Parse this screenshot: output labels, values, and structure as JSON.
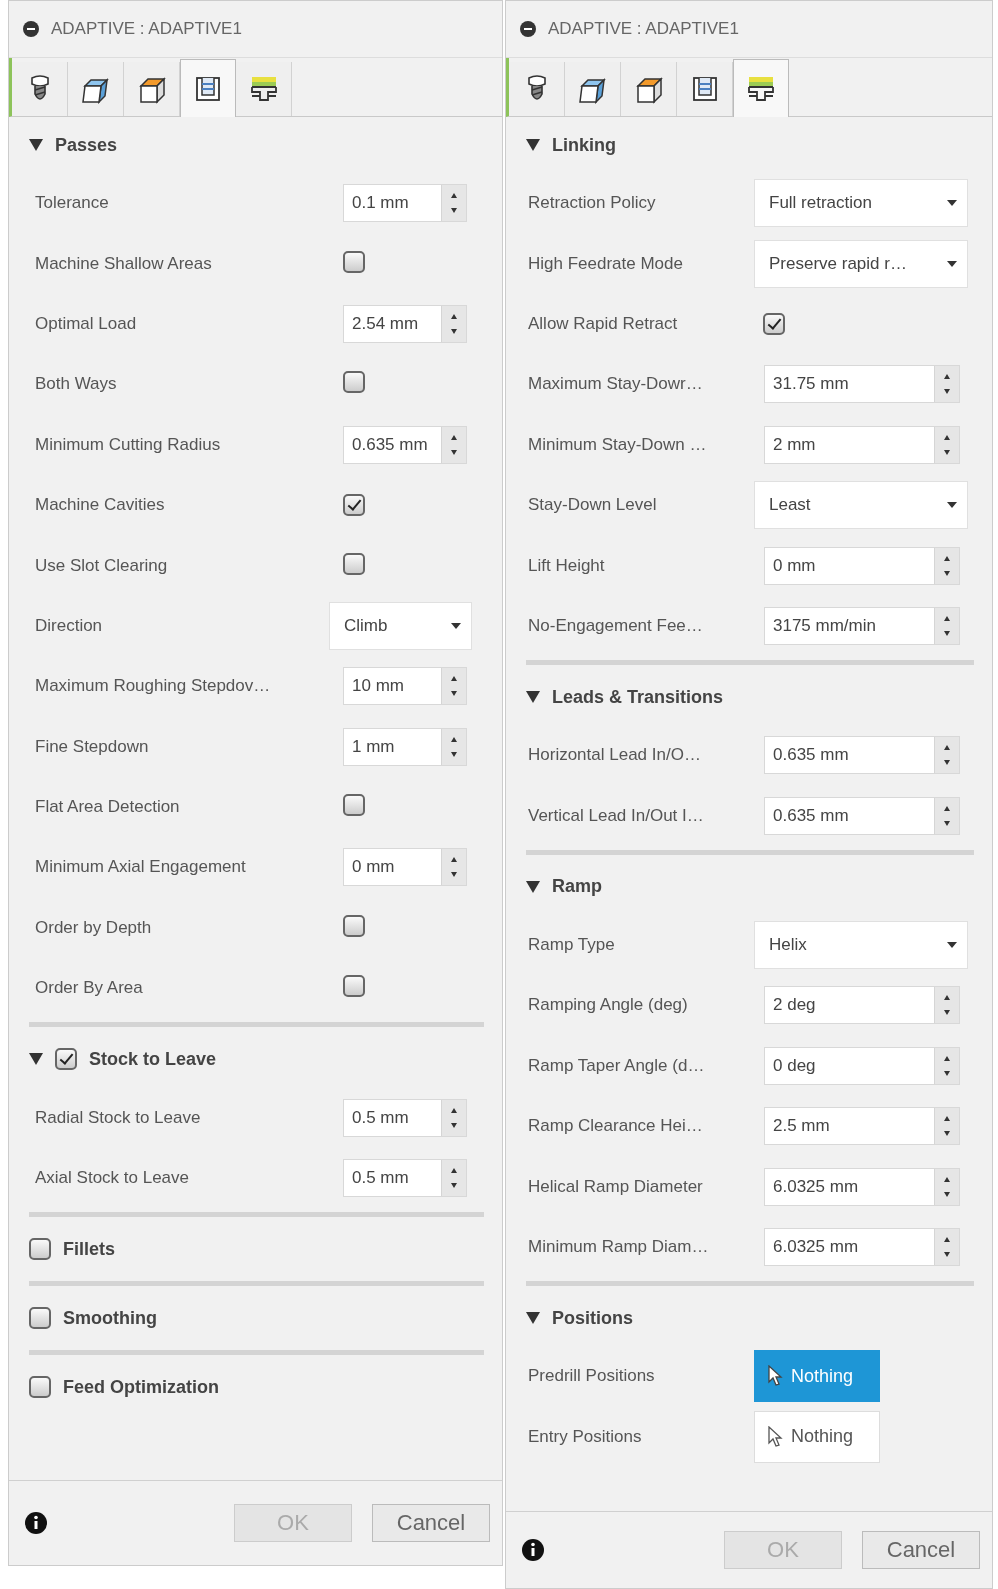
{
  "panels": [
    {
      "title": "ADAPTIVE : ADAPTIVE1",
      "tabs": [
        {
          "kind": "tool",
          "selected": false
        },
        {
          "kind": "geometry",
          "selected": false
        },
        {
          "kind": "heights",
          "selected": false
        },
        {
          "kind": "passes",
          "selected": true
        },
        {
          "kind": "linking",
          "selected": false
        }
      ],
      "sections": [
        {
          "kind": "group",
          "title": "Passes",
          "expanded": true,
          "rows": [
            {
              "kind": "spinner",
              "label": "Tolerance",
              "value": "0.1 mm"
            },
            {
              "kind": "checkbox",
              "label": "Machine Shallow Areas",
              "checked": false
            },
            {
              "kind": "spinner",
              "label": "Optimal Load",
              "value": "2.54 mm"
            },
            {
              "kind": "checkbox",
              "label": "Both Ways",
              "checked": false
            },
            {
              "kind": "spinner",
              "label": "Minimum Cutting Radius",
              "value": "0.635 mm"
            },
            {
              "kind": "checkbox",
              "label": "Machine Cavities",
              "checked": true
            },
            {
              "kind": "checkbox",
              "label": "Use Slot Clearing",
              "checked": false
            },
            {
              "kind": "dropdown",
              "label": "Direction",
              "value": "Climb"
            },
            {
              "kind": "spinner",
              "label": "Maximum Roughing Stepdov…",
              "value": "10 mm"
            },
            {
              "kind": "spinner",
              "label": "Fine Stepdown",
              "value": "1 mm"
            },
            {
              "kind": "checkbox",
              "label": "Flat Area Detection",
              "checked": false
            },
            {
              "kind": "spinner",
              "label": "Minimum Axial Engagement",
              "value": "0 mm"
            },
            {
              "kind": "checkbox",
              "label": "Order by Depth",
              "checked": false
            },
            {
              "kind": "checkbox",
              "label": "Order By Area",
              "checked": false
            }
          ]
        },
        {
          "kind": "check_group",
          "title": "Stock to Leave",
          "expanded": true,
          "checked": true,
          "rows": [
            {
              "kind": "spinner",
              "label": "Radial Stock to Leave",
              "value": "0.5 mm"
            },
            {
              "kind": "spinner",
              "label": "Axial Stock to Leave",
              "value": "0.5 mm"
            }
          ]
        },
        {
          "kind": "check",
          "title": "Fillets",
          "checked": false
        },
        {
          "kind": "check",
          "title": "Smoothing",
          "checked": false
        },
        {
          "kind": "check",
          "title": "Feed Optimization",
          "checked": false
        }
      ],
      "buttons": [
        {
          "label": "OK",
          "disabled": true
        },
        {
          "label": "Cancel",
          "disabled": false
        }
      ]
    },
    {
      "title": "ADAPTIVE : ADAPTIVE1",
      "tabs": [
        {
          "kind": "tool",
          "selected": false
        },
        {
          "kind": "geometry",
          "selected": false
        },
        {
          "kind": "heights",
          "selected": false
        },
        {
          "kind": "passes",
          "selected": false
        },
        {
          "kind": "linking",
          "selected": true
        }
      ],
      "sections": [
        {
          "kind": "group",
          "title": "Linking",
          "expanded": true,
          "rows": [
            {
              "kind": "dropdown",
              "label": "Retraction Policy",
              "value": "Full retraction"
            },
            {
              "kind": "dropdown",
              "label": "High Feedrate Mode",
              "value": "Preserve rapid r…"
            },
            {
              "kind": "checkbox",
              "label": "Allow Rapid Retract",
              "checked": true
            },
            {
              "kind": "spinner",
              "label": "Maximum Stay-Dowr…",
              "value": "31.75 mm"
            },
            {
              "kind": "spinner",
              "label": "Minimum Stay-Down …",
              "value": "2 mm"
            },
            {
              "kind": "dropdown",
              "label": "Stay-Down Level",
              "value": "Least"
            },
            {
              "kind": "spinner",
              "label": "Lift Height",
              "value": "0 mm"
            },
            {
              "kind": "spinner",
              "label": "No-Engagement Fee…",
              "value": "3175 mm/min"
            }
          ]
        },
        {
          "kind": "group",
          "title": "Leads & Transitions",
          "expanded": true,
          "rows": [
            {
              "kind": "spinner",
              "label": "Horizontal Lead In/O…",
              "value": "0.635 mm"
            },
            {
              "kind": "spinner",
              "label": "Vertical Lead In/Out I…",
              "value": "0.635 mm"
            }
          ]
        },
        {
          "kind": "group",
          "title": "Ramp",
          "expanded": true,
          "rows": [
            {
              "kind": "dropdown",
              "label": "Ramp Type",
              "value": "Helix"
            },
            {
              "kind": "spinner",
              "label": "Ramping Angle (deg)",
              "value": "2 deg"
            },
            {
              "kind": "spinner",
              "label": "Ramp Taper Angle (d…",
              "value": "0 deg"
            },
            {
              "kind": "spinner",
              "label": "Ramp Clearance Hei…",
              "value": "2.5 mm"
            },
            {
              "kind": "spinner",
              "label": "Helical Ramp Diameter",
              "value": "6.0325 mm"
            },
            {
              "kind": "spinner",
              "label": "Minimum Ramp Diam…",
              "value": "6.0325 mm"
            }
          ]
        },
        {
          "kind": "group",
          "title": "Positions",
          "expanded": true,
          "rows": [
            {
              "kind": "selection",
              "label": "Predrill Positions",
              "value": "Nothing",
              "selected": true
            },
            {
              "kind": "selection",
              "label": "Entry Positions",
              "value": "Nothing",
              "selected": false
            }
          ]
        }
      ],
      "buttons": [
        {
          "label": "OK",
          "disabled": true
        },
        {
          "label": "Cancel",
          "disabled": false
        }
      ]
    }
  ]
}
